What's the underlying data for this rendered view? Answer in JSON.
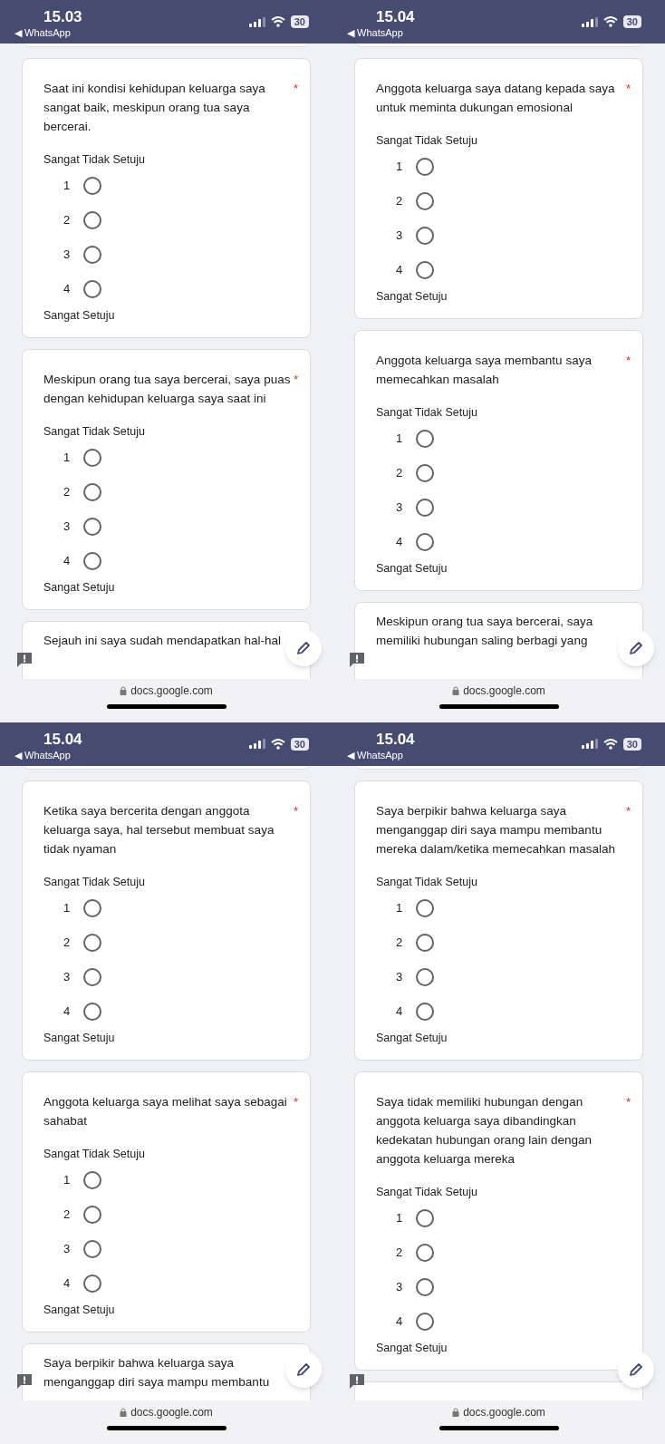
{
  "panes": [
    {
      "status_bar": {
        "time": "15.03",
        "back": "◀ WhatsApp",
        "battery": "30"
      },
      "cards": [
        {
          "question": "Saat ini kondisi kehidupan keluarga saya sangat baik, meskipun orang tua saya bercerai.",
          "required": "*",
          "low_label": "Sangat Tidak Setuju",
          "high_label": "Sangat Setuju",
          "options": [
            {
              "label": "1",
              "selected": false
            },
            {
              "label": "2",
              "selected": false
            },
            {
              "label": "3",
              "selected": false
            },
            {
              "label": "4",
              "selected": false
            }
          ]
        },
        {
          "question": "Meskipun orang tua saya bercerai, saya puas dengan kehidupan keluarga saya saat ini",
          "required": "*",
          "low_label": "Sangat Tidak Setuju",
          "high_label": "Sangat Setuju",
          "options": [
            {
              "label": "1",
              "selected": false
            },
            {
              "label": "2",
              "selected": false
            },
            {
              "label": "3",
              "selected": false
            },
            {
              "label": "4",
              "selected": false
            }
          ]
        },
        {
          "question": "Sejauh ini saya sudah mendapatkan hal-hal"
        }
      ],
      "url": "docs.google.com"
    },
    {
      "status_bar": {
        "time": "15.04",
        "back": "◀ WhatsApp",
        "battery": "30"
      },
      "cards": [
        {
          "question": "Anggota keluarga saya datang kepada saya untuk meminta dukungan emosional",
          "required": "*",
          "low_label": "Sangat Tidak Setuju",
          "high_label": "Sangat Setuju",
          "options": [
            {
              "label": "1",
              "selected": false
            },
            {
              "label": "2",
              "selected": false
            },
            {
              "label": "3",
              "selected": false
            },
            {
              "label": "4",
              "selected": false
            }
          ]
        },
        {
          "question": "Anggota keluarga saya membantu saya memecahkan masalah",
          "required": "*",
          "low_label": "Sangat Tidak Setuju",
          "high_label": "Sangat Setuju",
          "options": [
            {
              "label": "1",
              "selected": false
            },
            {
              "label": "2",
              "selected": false
            },
            {
              "label": "3",
              "selected": false
            },
            {
              "label": "4",
              "selected": false
            }
          ]
        },
        {
          "question": "Meskipun orang tua saya bercerai, saya memiliki hubungan saling berbagi yang"
        }
      ],
      "url": "docs.google.com"
    },
    {
      "status_bar": {
        "time": "15.04",
        "back": "◀ WhatsApp",
        "battery": "30"
      },
      "cards": [
        {
          "question": "Ketika saya bercerita dengan anggota keluarga saya, hal tersebut membuat saya tidak nyaman",
          "required": "*",
          "low_label": "Sangat Tidak Setuju",
          "high_label": "Sangat Setuju",
          "options": [
            {
              "label": "1",
              "selected": false
            },
            {
              "label": "2",
              "selected": false
            },
            {
              "label": "3",
              "selected": false
            },
            {
              "label": "4",
              "selected": false
            }
          ]
        },
        {
          "question": "Anggota keluarga saya melihat saya sebagai sahabat",
          "required": "*",
          "low_label": "Sangat Tidak Setuju",
          "high_label": "Sangat Setuju",
          "options": [
            {
              "label": "1",
              "selected": false
            },
            {
              "label": "2",
              "selected": false
            },
            {
              "label": "3",
              "selected": false
            },
            {
              "label": "4",
              "selected": false
            }
          ]
        },
        {
          "question": "Saya berpikir bahwa keluarga saya menganggap diri saya mampu membantu"
        }
      ],
      "url": "docs.google.com"
    },
    {
      "status_bar": {
        "time": "15.04",
        "back": "◀ WhatsApp",
        "battery": "30"
      },
      "cards": [
        {
          "question": "Saya berpikir bahwa keluarga saya menganggap diri saya mampu membantu mereka dalam/ketika memecahkan masalah",
          "required": "*",
          "low_label": "Sangat Tidak Setuju",
          "high_label": "Sangat Setuju",
          "options": [
            {
              "label": "1",
              "selected": false
            },
            {
              "label": "2",
              "selected": false
            },
            {
              "label": "3",
              "selected": false
            },
            {
              "label": "4",
              "selected": false
            }
          ]
        },
        {
          "question": "Saya tidak memiliki hubungan dengan anggota keluarga saya dibandingkan kedekatan hubungan orang lain dengan anggota keluarga mereka",
          "required": "*",
          "low_label": "Sangat Tidak Setuju",
          "high_label": "Sangat Setuju",
          "options": [
            {
              "label": "1",
              "selected": false
            },
            {
              "label": "2",
              "selected": false
            },
            {
              "label": "3",
              "selected": false
            },
            {
              "label": "4",
              "selected": false
            }
          ]
        },
        {
          "kind": "blank"
        }
      ],
      "url": "docs.google.com"
    }
  ]
}
